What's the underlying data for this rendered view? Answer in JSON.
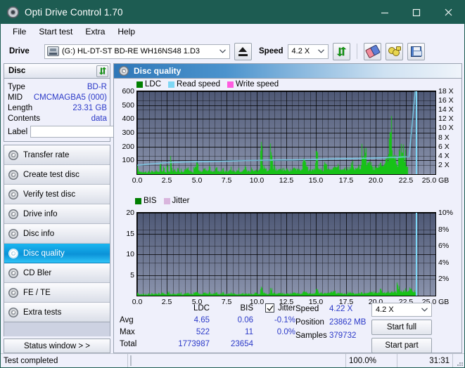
{
  "window": {
    "title": "Opti Drive Control 1.70",
    "icon": "disc-icon",
    "minimize": "—",
    "maximize": "☐",
    "close": "✕"
  },
  "menu": {
    "items": [
      "File",
      "Start test",
      "Extra",
      "Help"
    ]
  },
  "drivebar": {
    "drive_label": "Drive",
    "drive_value": "(G:)  HL-DT-ST BD-RE  WH16NS48 1.D3",
    "eject_icon": "eject-icon",
    "speed_label": "Speed",
    "speed_value": "4.2 X",
    "refresh_icon": "refresh-icon",
    "eraser_icon": "eraser-icon",
    "keys_icon": "keys-icon",
    "save_icon": "save-icon"
  },
  "disc_panel": {
    "header": "Disc",
    "refresh_icon": "refresh-icon",
    "rows": [
      {
        "key": "Type",
        "value": "BD-R"
      },
      {
        "key": "MID",
        "value": "CMCMAGBA5 (000)"
      },
      {
        "key": "Length",
        "value": "23.31 GB"
      },
      {
        "key": "Contents",
        "value": "data"
      }
    ],
    "label_key": "Label",
    "label_value": "",
    "label_placeholder": "",
    "cd_button_icon": "cd-icon"
  },
  "nav": {
    "items": [
      {
        "label": "Transfer rate",
        "active": false
      },
      {
        "label": "Create test disc",
        "active": false
      },
      {
        "label": "Verify test disc",
        "active": false
      },
      {
        "label": "Drive info",
        "active": false
      },
      {
        "label": "Disc info",
        "active": false
      },
      {
        "label": "Disc quality",
        "active": true
      },
      {
        "label": "CD Bler",
        "active": false
      },
      {
        "label": "FE / TE",
        "active": false
      },
      {
        "label": "Extra tests",
        "active": false
      }
    ],
    "status_window": "Status window > >"
  },
  "content": {
    "header_title": "Disc quality",
    "header_icon": "disc-icon"
  },
  "stats": {
    "columns": [
      "",
      "LDC",
      "BIS",
      "Jitter"
    ],
    "jitter_checked": true,
    "jitter_label": "Jitter",
    "rows": [
      {
        "name": "Avg",
        "ldc": "4.65",
        "bis": "0.06",
        "jitter": "-0.1%"
      },
      {
        "name": "Max",
        "ldc": "522",
        "bis": "11",
        "jitter": "0.0%"
      },
      {
        "name": "Total",
        "ldc": "1773987",
        "bis": "23654",
        "jitter": ""
      }
    ],
    "info": [
      {
        "key": "Speed",
        "value": "4.22 X"
      },
      {
        "key": "Position",
        "value": "23862 MB"
      },
      {
        "key": "Samples",
        "value": "379732"
      }
    ],
    "speed_select": "4.2 X",
    "start_full": "Start full",
    "start_part": "Start part"
  },
  "statusbar": {
    "text": "Test completed",
    "percent": "100.0%",
    "percent_value": 100,
    "time": "31:31"
  },
  "colors": {
    "accent": "#2b39c8",
    "ldc_green": "#17c217",
    "read_speed": "#7fd7f5",
    "write_speed": "#ff5ce0",
    "jitter": "#d9b5dd",
    "titlebar": "#1d5c52",
    "plot_bg_top": "#4e5875",
    "plot_bg_bottom": "#8a93ac"
  },
  "chart_data": [
    {
      "id": "quality-chart",
      "type": "area",
      "title": "",
      "xlabel": "GB",
      "ylabel": "",
      "y2label": "X",
      "xlim": [
        0,
        25
      ],
      "ylim": [
        0,
        600
      ],
      "y2lim": [
        0,
        18
      ],
      "grid": true,
      "legend_position": "top-left",
      "legend": [
        {
          "name": "LDC",
          "color": "#007f00"
        },
        {
          "name": "Read speed",
          "color": "#7fd7f5"
        },
        {
          "name": "Write speed",
          "color": "#ff5ce0"
        }
      ],
      "xticks": [
        "0.0",
        "2.5",
        "5.0",
        "7.5",
        "10.0",
        "12.5",
        "15.0",
        "17.5",
        "20.0",
        "22.5",
        "25.0"
      ],
      "yticks": [
        100,
        200,
        300,
        400,
        500,
        600
      ],
      "y2ticks": [
        "2 X",
        "4 X",
        "6 X",
        "8 X",
        "10 X",
        "12 X",
        "14 X",
        "16 X",
        "18 X"
      ],
      "series": [
        {
          "name": "LDC",
          "color": "#17c217",
          "x": [
            0.0,
            0.1,
            0.2,
            0.3,
            0.4,
            0.5,
            0.6,
            0.7,
            0.8,
            0.9,
            1.0,
            1.1,
            1.2,
            1.3,
            1.4,
            1.5,
            1.6,
            1.7,
            1.8,
            1.9,
            2.0,
            2.1,
            2.2,
            2.3,
            2.4,
            2.5,
            2.6,
            2.7,
            2.8,
            2.9,
            3.0,
            3.1,
            3.2,
            3.3,
            3.4,
            3.5,
            3.6,
            3.7,
            3.8,
            3.9,
            4.0,
            4.2,
            4.4,
            4.6,
            4.8,
            5.0,
            5.2,
            5.4,
            5.6,
            5.8,
            6.0,
            6.2,
            6.4,
            6.6,
            6.8,
            7.0,
            7.2,
            7.4,
            7.6,
            7.8,
            8.0,
            8.2,
            8.4,
            8.6,
            8.8,
            9.0,
            9.2,
            9.4,
            9.6,
            9.8,
            10.0,
            10.2,
            10.4,
            10.5,
            10.6,
            10.8,
            11.0,
            11.2,
            11.3,
            11.4,
            11.6,
            11.8,
            12.0,
            12.4,
            12.8,
            13.2,
            13.6,
            14.0,
            14.2,
            14.4,
            14.8,
            15.0,
            15.2,
            15.4,
            15.8,
            16.0,
            16.2,
            16.4,
            16.8,
            17.0,
            17.4,
            17.8,
            18.0,
            18.2,
            18.6,
            19.0,
            19.4,
            19.8,
            20.0,
            20.2,
            20.4,
            20.6,
            20.8,
            21.0,
            21.2,
            21.4,
            21.6,
            21.8,
            21.9,
            22.0,
            22.2,
            22.4,
            22.6,
            22.8,
            23.0,
            23.2,
            23.3
          ],
          "y": [
            130,
            40,
            25,
            20,
            22,
            18,
            30,
            22,
            18,
            25,
            20,
            18,
            30,
            22,
            18,
            25,
            30,
            22,
            18,
            110,
            35,
            25,
            60,
            28,
            22,
            75,
            30,
            25,
            180,
            40,
            28,
            55,
            30,
            25,
            50,
            28,
            22,
            45,
            30,
            25,
            40,
            55,
            30,
            25,
            60,
            100,
            35,
            28,
            45,
            30,
            60,
            28,
            25,
            50,
            30,
            28,
            45,
            30,
            28,
            55,
            30,
            25,
            48,
            30,
            28,
            70,
            35,
            28,
            50,
            30,
            40,
            55,
            260,
            120,
            60,
            45,
            50,
            240,
            150,
            70,
            45,
            40,
            50,
            45,
            40,
            55,
            42,
            130,
            70,
            45,
            50,
            170,
            60,
            45,
            90,
            55,
            45,
            60,
            80,
            50,
            60,
            55,
            110,
            60,
            70,
            230,
            100,
            65,
            90,
            75,
            110,
            95,
            140,
            170,
            460,
            240,
            150,
            110,
            190,
            210,
            230,
            180,
            60
          ]
        },
        {
          "name": "Read speed",
          "color": "#7fd7f5",
          "x": [
            0.0,
            0.5,
            1.0,
            1.5,
            2.0,
            2.5,
            3.0,
            3.5,
            4.0,
            5.0,
            6.0,
            7.0,
            8.0,
            9.0,
            10.0,
            11.0,
            12.0,
            13.0,
            14.0,
            15.0,
            16.0,
            17.0,
            18.0,
            19.0,
            20.0,
            21.0,
            22.0,
            22.8,
            23.3
          ],
          "y": [
            1.95,
            2.05,
            2.2,
            2.3,
            2.4,
            2.5,
            2.55,
            2.6,
            2.65,
            2.7,
            2.75,
            2.8,
            2.85,
            2.95,
            3.0,
            3.05,
            3.1,
            3.1,
            3.15,
            3.2,
            3.3,
            3.35,
            3.4,
            3.45,
            3.5,
            3.6,
            3.7,
            3.8,
            18.0
          ],
          "axis": "y2"
        }
      ]
    },
    {
      "id": "bis-chart",
      "type": "area",
      "title": "",
      "xlabel": "GB",
      "ylabel": "",
      "y2label": "%",
      "xlim": [
        0,
        25
      ],
      "ylim": [
        0,
        20
      ],
      "y2lim": [
        0,
        10
      ],
      "grid": true,
      "legend_position": "top-left",
      "legend": [
        {
          "name": "BIS",
          "color": "#007f00"
        },
        {
          "name": "Jitter",
          "color": "#d9b5dd"
        }
      ],
      "xticks": [
        "0.0",
        "2.5",
        "5.0",
        "7.5",
        "10.0",
        "12.5",
        "15.0",
        "17.5",
        "20.0",
        "22.5",
        "25.0"
      ],
      "yticks": [
        5,
        10,
        15,
        20
      ],
      "y2ticks": [
        "2%",
        "4%",
        "6%",
        "8%",
        "10%"
      ],
      "series": [
        {
          "name": "BIS",
          "color": "#17c217",
          "x": [
            0.0,
            0.1,
            0.2,
            0.3,
            0.4,
            0.5,
            0.6,
            0.7,
            0.8,
            0.9,
            1.0,
            1.1,
            1.2,
            1.3,
            1.4,
            1.5,
            1.6,
            1.7,
            1.8,
            1.9,
            2.0,
            2.2,
            2.4,
            2.6,
            2.8,
            3.0,
            3.2,
            3.4,
            3.6,
            3.8,
            4.0,
            4.2,
            4.4,
            4.6,
            4.8,
            5.0,
            5.2,
            5.4,
            5.6,
            5.8,
            6.0,
            6.2,
            6.4,
            6.6,
            6.8,
            7.0,
            7.2,
            7.4,
            7.6,
            7.8,
            8.0,
            8.4,
            8.8,
            9.2,
            9.6,
            10.0,
            10.2,
            10.4,
            10.6,
            10.8,
            11.0,
            11.2,
            11.4,
            11.6,
            11.8,
            12.0,
            12.4,
            12.8,
            13.2,
            13.6,
            14.0,
            14.4,
            14.8,
            15.0,
            15.4,
            15.8,
            16.0,
            16.4,
            16.8,
            17.0,
            17.4,
            17.8,
            18.0,
            18.4,
            18.8,
            19.2,
            19.6,
            20.0,
            20.2,
            20.4,
            20.6,
            20.8,
            21.0,
            21.2,
            21.4,
            21.6,
            21.8,
            21.9,
            22.0,
            22.2,
            22.4,
            22.6,
            22.8,
            23.0,
            23.2,
            23.3
          ],
          "y": [
            1.6,
            0.6,
            0.4,
            0.5,
            0.4,
            0.6,
            0.4,
            0.5,
            0.4,
            0.6,
            0.5,
            0.4,
            0.7,
            0.5,
            0.4,
            0.6,
            0.5,
            0.4,
            0.7,
            0.5,
            1.0,
            0.6,
            0.5,
            1.1,
            0.6,
            0.8,
            0.5,
            0.6,
            0.9,
            0.5,
            0.6,
            0.8,
            0.5,
            0.6,
            0.9,
            1.0,
            0.6,
            0.5,
            0.8,
            0.6,
            0.9,
            0.5,
            0.6,
            0.8,
            0.5,
            0.6,
            0.9,
            0.5,
            0.6,
            0.8,
            0.6,
            0.5,
            0.7,
            0.6,
            0.5,
            0.9,
            0.6,
            2.4,
            0.8,
            0.6,
            0.7,
            2.0,
            0.8,
            0.6,
            0.7,
            0.8,
            0.6,
            0.7,
            0.9,
            0.6,
            1.2,
            0.8,
            0.7,
            1.6,
            0.9,
            0.7,
            1.0,
            1.3,
            0.8,
            0.9,
            0.7,
            1.0,
            0.8,
            0.7,
            0.9,
            0.8,
            1.0,
            1.3,
            1.0,
            2.2,
            1.1,
            0.9,
            1.2,
            1.1,
            1.4,
            1.2,
            5.4,
            2.4,
            1.6,
            1.3,
            1.8,
            1.1,
            2.0,
            1.9,
            1.5,
            0.9
          ]
        },
        {
          "name": "Jitter",
          "color": "#d9b5dd",
          "x": [],
          "y": [],
          "axis": "y2"
        }
      ]
    }
  ]
}
